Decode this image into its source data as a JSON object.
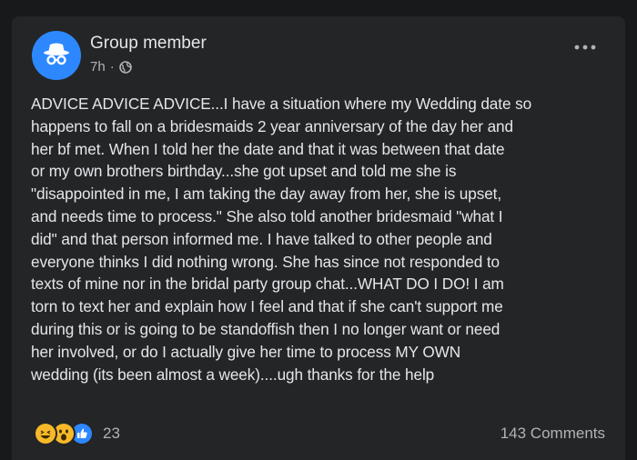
{
  "post": {
    "author": "Group member",
    "time": "7h",
    "separator": "·",
    "privacy_icon": "globe-icon",
    "more_icon": "more-options-icon",
    "avatar_icon": "anonymous-member-icon",
    "text": "ADVICE ADVICE ADVICE...I have a situation where my Wedding date so\nhappens to fall on a bridesmaids 2 year anniversary of the day her and\nher bf met. When I told her the date and that it was between that date\nor my own brothers birthday...she got upset and told me she is\n\"disappointed in me, I am taking the day away from her, she is upset,\nand needs time to process.\" She also told another bridesmaid \"what I\ndid\" and that person informed me. I have talked to other people and\neveryone thinks I did nothing wrong. She has since not responded to\ntexts of mine nor in the bridal party group chat...WHAT DO I DO! I am\ntorn to text her and explain how I feel and that if she can't support me\nduring this or is going to be standoffish then I no longer want or need\nher involved, or do I actually give her time to process MY OWN\nwedding (its been almost a week)....ugh thanks for the help"
  },
  "footer": {
    "reactions": [
      "haha-reaction-icon",
      "wow-reaction-icon",
      "like-reaction-icon"
    ],
    "reaction_count": "23",
    "comments": "143 Comments"
  },
  "colors": {
    "background": "#18191a",
    "card": "#242526",
    "accent": "#2d88ff",
    "text_primary": "#e4e6eb",
    "text_secondary": "#b0b3b8"
  }
}
